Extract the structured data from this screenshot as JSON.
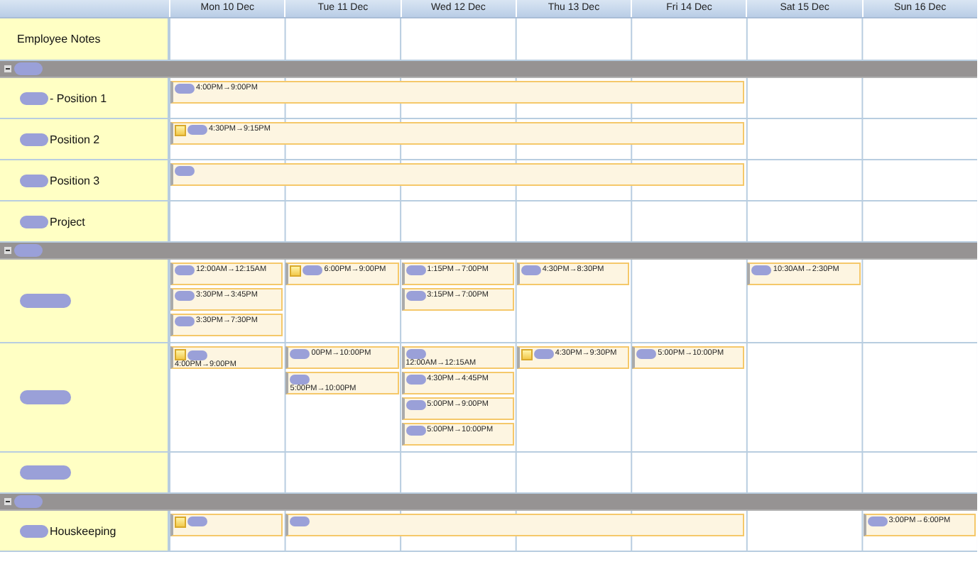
{
  "days": [
    "Mon 10 Dec",
    "Tue 11 Dec",
    "Wed 12 Dec",
    "Thu 13 Dec",
    "Fri 14 Dec",
    "Sat 15 Dec",
    "Sun 16 Dec"
  ],
  "sections": [
    {
      "kind": "notes",
      "label": "Employee Notes"
    },
    {
      "kind": "group",
      "expanded": true,
      "redacted": true
    },
    {
      "kind": "resource",
      "label": "- Position 1",
      "redacted": true,
      "cells": [
        {
          "events": [
            {
              "kind": "inline",
              "note": false,
              "redacted": true,
              "time": "4:00PM→9:00PM"
            }
          ]
        },
        {
          "joined": true
        },
        {
          "joined": true
        },
        {
          "joined": true
        },
        {
          "joined": true
        }
      ]
    },
    {
      "kind": "resource",
      "label": "Position 2",
      "redacted": true,
      "cells": [
        {
          "events": [
            {
              "kind": "inline",
              "note": true,
              "redacted": true,
              "time": "4:30PM→9:15PM"
            }
          ]
        },
        {
          "joined": true
        },
        {
          "joined": true
        },
        {
          "joined": true
        },
        {
          "joined": true
        }
      ]
    },
    {
      "kind": "resource",
      "label": "Position 3",
      "redacted": true,
      "cells": [
        {
          "events": [
            {
              "kind": "inline",
              "note": false,
              "redacted": true
            }
          ]
        },
        {
          "joined": true
        },
        {
          "joined": true
        },
        {
          "joined": true
        },
        {
          "joined": true
        }
      ]
    },
    {
      "kind": "resource",
      "label": "Project",
      "redacted": true
    },
    {
      "kind": "group",
      "expanded": true,
      "redacted": true
    },
    {
      "kind": "resource",
      "redacted": true,
      "cells": [
        {
          "events": [
            {
              "kind": "inline",
              "note": false,
              "redacted": true,
              "time": "12:00AM→12:15AM"
            },
            {
              "kind": "inline",
              "note": false,
              "redacted": true,
              "time": "3:30PM→3:45PM"
            },
            {
              "kind": "inline",
              "note": false,
              "redacted": true,
              "time": "3:30PM→7:30PM"
            }
          ]
        },
        {
          "events": [
            {
              "kind": "inline",
              "note": true,
              "redacted": true,
              "time": "6:00PM→9:00PM"
            }
          ]
        },
        {
          "events": [
            {
              "kind": "inline",
              "note": false,
              "redacted": true,
              "time": "1:15PM→7:00PM"
            },
            {
              "kind": "inline",
              "note": false,
              "redacted": true,
              "time": "3:15PM→7:00PM"
            }
          ]
        },
        {
          "events": [
            {
              "kind": "inline",
              "note": false,
              "redacted": true,
              "time": "4:30PM→8:30PM"
            }
          ]
        },
        {},
        {
          "events": [
            {
              "kind": "inline",
              "note": false,
              "redacted": true,
              "time": "10:30AM→2:30PM"
            }
          ]
        }
      ]
    },
    {
      "kind": "resource",
      "redacted": true,
      "cells": [
        {
          "events": [
            {
              "kind": "stacked",
              "note": true,
              "redacted": true,
              "time": "4:00PM→9:00PM"
            }
          ]
        },
        {
          "events": [
            {
              "kind": "inline",
              "note": false,
              "redacted": true,
              "time": "00PM→10:00PM"
            },
            {
              "kind": "stacked",
              "note": false,
              "redacted": true,
              "time": "5:00PM→10:00PM"
            }
          ]
        },
        {
          "events": [
            {
              "kind": "stacked",
              "note": false,
              "redacted": true,
              "time": "12:00AM→12:15AM"
            },
            {
              "kind": "inline",
              "note": false,
              "redacted": true,
              "time": "4:30PM→4:45PM"
            },
            {
              "kind": "inline",
              "note": false,
              "redacted": true,
              "time": "5:00PM→9:00PM"
            },
            {
              "kind": "inline",
              "note": false,
              "redacted": true,
              "time": "5:00PM→10:00PM"
            }
          ]
        },
        {
          "events": [
            {
              "kind": "inline",
              "note": true,
              "redacted": true,
              "time": "4:30PM→9:30PM"
            }
          ]
        },
        {
          "events": [
            {
              "kind": "inline",
              "note": false,
              "redacted": true,
              "time": "5:00PM→10:00PM"
            }
          ]
        }
      ]
    },
    {
      "kind": "resource",
      "redacted": true
    },
    {
      "kind": "group",
      "expanded": true,
      "redacted": true
    },
    {
      "kind": "resource",
      "label": "Houskeeping",
      "redacted": true,
      "cells": [
        {
          "events": [
            {
              "kind": "inline",
              "note": true,
              "redacted": true
            }
          ]
        },
        {
          "events": [
            {
              "kind": "inline",
              "note": false,
              "redacted": true
            }
          ]
        },
        {
          "joined": true
        },
        {
          "joined": true
        },
        {
          "joined": true
        },
        {},
        {
          "events": [
            {
              "kind": "inline",
              "note": false,
              "redacted": true,
              "time": "3:00PM→6:00PM"
            }
          ]
        }
      ]
    }
  ]
}
